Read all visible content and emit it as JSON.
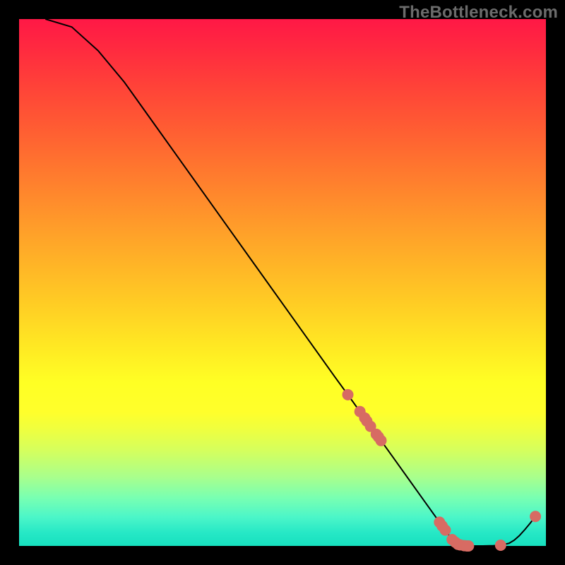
{
  "watermark": "TheBottleneck.com",
  "chart_data": {
    "type": "line",
    "title": "",
    "xlabel": "",
    "ylabel": "",
    "xlim": [
      0,
      100
    ],
    "ylim": [
      0,
      100
    ],
    "line": {
      "x": [
        5,
        10,
        15,
        20,
        25,
        30,
        35,
        40,
        45,
        50,
        55,
        60,
        62.4,
        64.7,
        65.6,
        66.0,
        66.7,
        67.8,
        68.2,
        68.7,
        71,
        74,
        77,
        79.8,
        80.3,
        80.9,
        82.2,
        82.8,
        83.3,
        83.7,
        84.5,
        85.0,
        85.3,
        86,
        88,
        90,
        91.4,
        93,
        94,
        95,
        96,
        97,
        98
      ],
      "y": [
        100,
        98.5,
        94,
        88,
        81,
        74,
        67,
        60,
        53,
        46,
        39,
        32,
        28.7,
        25.5,
        24.3,
        23.7,
        22.7,
        21.2,
        20.7,
        20.0,
        16.8,
        12.6,
        8.4,
        4.5,
        3.8,
        3.0,
        1.2,
        0.7,
        0.3,
        0.2,
        0.05,
        0,
        0,
        0,
        0,
        0.05,
        0.13,
        0.5,
        1.1,
        2.0,
        3.1,
        4.3,
        5.6
      ]
    },
    "markers": {
      "x": [
        62.4,
        64.7,
        65.6,
        66.0,
        66.7,
        67.8,
        68.2,
        68.7,
        79.8,
        80.3,
        80.9,
        82.2,
        82.8,
        83.3,
        83.7,
        84.5,
        85.0,
        85.3,
        91.4,
        98.0
      ],
      "y": [
        28.7,
        25.5,
        24.3,
        23.7,
        22.7,
        21.2,
        20.7,
        20.0,
        4.5,
        3.8,
        3.0,
        1.2,
        0.7,
        0.3,
        0.2,
        0.05,
        0.0,
        0.0,
        0.13,
        5.6
      ],
      "color": "#d76b63",
      "size": 8
    },
    "line_color": "#000000",
    "line_width": 2,
    "grid": false,
    "legend": false
  }
}
